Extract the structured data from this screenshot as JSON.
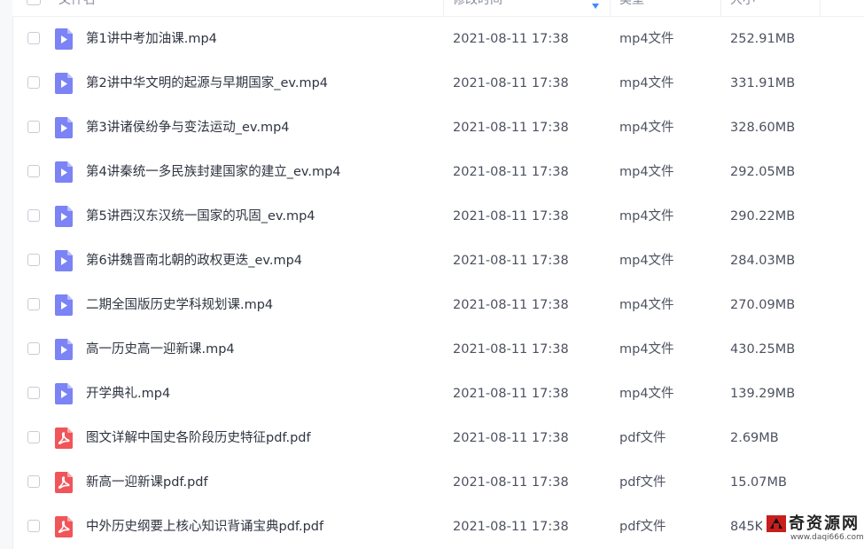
{
  "header": {
    "name_label": "文件名",
    "time_label": "修改时间",
    "type_label": "类型",
    "size_label": "大小"
  },
  "files": [
    {
      "name": "第1讲中考加油课.mp4",
      "time": "2021-08-11 17:38",
      "type": "mp4文件",
      "size": "252.91MB",
      "kind": "video"
    },
    {
      "name": "第2讲中华文明的起源与早期国家_ev.mp4",
      "time": "2021-08-11 17:38",
      "type": "mp4文件",
      "size": "331.91MB",
      "kind": "video"
    },
    {
      "name": "第3讲诸侯纷争与变法运动_ev.mp4",
      "time": "2021-08-11 17:38",
      "type": "mp4文件",
      "size": "328.60MB",
      "kind": "video"
    },
    {
      "name": "第4讲秦统一多民族封建国家的建立_ev.mp4",
      "time": "2021-08-11 17:38",
      "type": "mp4文件",
      "size": "292.05MB",
      "kind": "video"
    },
    {
      "name": "第5讲西汉东汉统一国家的巩固_ev.mp4",
      "time": "2021-08-11 17:38",
      "type": "mp4文件",
      "size": "290.22MB",
      "kind": "video"
    },
    {
      "name": "第6讲魏晋南北朝的政权更迭_ev.mp4",
      "time": "2021-08-11 17:38",
      "type": "mp4文件",
      "size": "284.03MB",
      "kind": "video"
    },
    {
      "name": "二期全国版历史学科规划课.mp4",
      "time": "2021-08-11 17:38",
      "type": "mp4文件",
      "size": "270.09MB",
      "kind": "video"
    },
    {
      "name": "高一历史高一迎新课.mp4",
      "time": "2021-08-11 17:38",
      "type": "mp4文件",
      "size": "430.25MB",
      "kind": "video"
    },
    {
      "name": "开学典礼.mp4",
      "time": "2021-08-11 17:38",
      "type": "mp4文件",
      "size": "139.29MB",
      "kind": "video"
    },
    {
      "name": "图文详解中国史各阶段历史特征pdf.pdf",
      "time": "2021-08-11 17:38",
      "type": "pdf文件",
      "size": "2.69MB",
      "kind": "pdf"
    },
    {
      "name": "新高一迎新课pdf.pdf",
      "time": "2021-08-11 17:38",
      "type": "pdf文件",
      "size": "15.07MB",
      "kind": "pdf"
    },
    {
      "name": "中外历史纲要上核心知识背诵宝典pdf.pdf",
      "time": "2021-08-11 17:38",
      "type": "pdf文件",
      "size": "845K",
      "kind": "pdf"
    }
  ],
  "icons": {
    "video_color": "#7b83f5",
    "pdf_color": "#f0555a"
  },
  "watermark": {
    "text": "奇资源网",
    "url": "www.daqi666.com"
  }
}
